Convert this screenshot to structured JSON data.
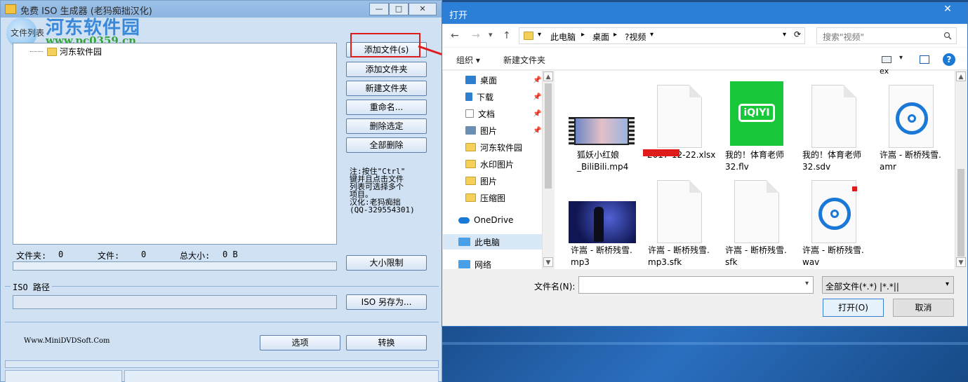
{
  "left_app": {
    "title": "免费 ISO 生成器 (老犸痴拙汉化)",
    "watermark": {
      "site_cn": "河东软件园",
      "site_url": "www.pc0359.cn"
    },
    "window_buttons": {
      "minimize": "—",
      "maximize": "□",
      "close": "✕"
    },
    "file_list_label": "文件列表",
    "tree_root": "河东软件园",
    "buttons": {
      "add_files": "添加文件(s)",
      "add_folder": "添加文件夹",
      "new_folder": "新建文件夹",
      "rename": "重命名...",
      "delete_selected": "删除选定",
      "delete_all": "全部删除",
      "size_limit": "大小限制",
      "iso_save_as": "ISO 另存为...",
      "options": "选项",
      "convert": "转换"
    },
    "note": "注:按住\"Ctrl\"\n键并且点击文件\n列表可选择多个\n项目。\n汉化:老犸痴拙\n(QQ-329554301)",
    "stats": {
      "folders_label": "文件夹:",
      "folders_value": "0",
      "files_label": "文件:",
      "files_value": "0",
      "total_label": "总大小:",
      "total_value": "0 B"
    },
    "iso_path_label": "ISO 路径",
    "iso_path_value": "",
    "site": "Www.MiniDVDSoft.Com"
  },
  "open_dialog": {
    "title": "打开",
    "close": "✕",
    "nav": {
      "back": "←",
      "forward": "→",
      "dropdown": "▾",
      "up": "↑",
      "refresh": "⟳"
    },
    "breadcrumb": [
      "此电脑",
      "桌面",
      "?视频"
    ],
    "search_placeholder": "搜索\"视频\"",
    "toolbar": {
      "organize": "组织 ▾",
      "new_folder": "新建文件夹",
      "help": "?"
    },
    "nav_items": [
      {
        "label": "桌面",
        "color": "#2e7fd0",
        "pinned": true
      },
      {
        "label": "下载",
        "color": "#2e7fd0",
        "pinned": true
      },
      {
        "label": "文档",
        "color": "#8a8a8a",
        "pinned": true
      },
      {
        "label": "图片",
        "color": "#6b8fb3",
        "pinned": true
      },
      {
        "label": "河东软件园",
        "color": "#f4cf5a",
        "pinned": false
      },
      {
        "label": "水印图片",
        "color": "#f4cf5a",
        "pinned": false
      },
      {
        "label": "图片",
        "color": "#f4cf5a",
        "pinned": false
      },
      {
        "label": "压缩图",
        "color": "#f4cf5a",
        "pinned": false
      },
      {
        "label": "OneDrive",
        "color": "#1a79d6",
        "pinned": false
      },
      {
        "label": "此电脑",
        "color": "#4aa0e6",
        "pinned": false,
        "selected": true
      },
      {
        "label": "网络",
        "color": "#4aa0e6",
        "pinned": false
      }
    ],
    "partial_top_label": "ex",
    "files": [
      {
        "name": "狐妖小红娘\n_BiliBili.mp4",
        "kind": "video"
      },
      {
        "name": "2017-12-22.xlsx",
        "kind": "doc"
      },
      {
        "name": "我的！体育老师\n32.flv",
        "kind": "iqiyi"
      },
      {
        "name": "我的！体育老师\n32.sdv",
        "kind": "doc"
      },
      {
        "name": "许嵩 - 断桥残雪.\namr",
        "kind": "groove"
      },
      {
        "name": "许嵩 - 断桥残雪.\nmp3",
        "kind": "concert"
      },
      {
        "name": "许嵩 - 断桥残雪.\nmp3.sfk",
        "kind": "doc"
      },
      {
        "name": "许嵩 - 断桥残雪.\nsfk",
        "kind": "doc"
      },
      {
        "name": "许嵩 - 断桥残雪.\nwav",
        "kind": "groove"
      }
    ],
    "filename_label": "文件名(N):",
    "filename_value": "",
    "filetype_value": "全部文件(*.*)  |*.*||",
    "open_button": "打开(O)",
    "cancel_button": "取消",
    "colors": {
      "titlebar": "#2b7fd6",
      "accent_red": "#e01b1b"
    }
  }
}
